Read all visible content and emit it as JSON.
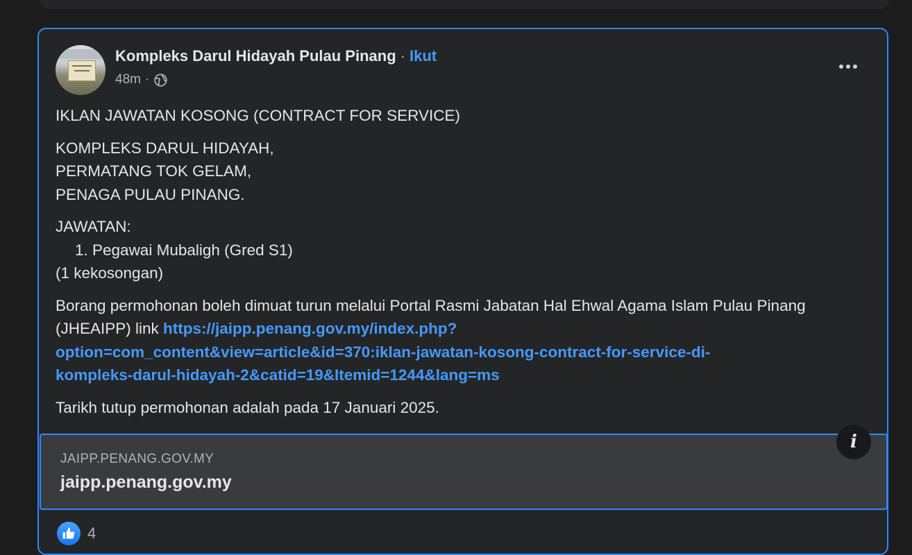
{
  "post": {
    "author": "Kompleks Darul Hidayah Pulau Pinang",
    "separator": "·",
    "follow_label": "Ikut",
    "time": "48m",
    "meta_separator": "·",
    "privacy_icon": "globe-icon",
    "more_icon": "more-options-icon",
    "body": {
      "p1": "IKLAN JAWATAN KOSONG (CONTRACT FOR SERVICE)",
      "address": [
        "KOMPLEKS DARUL HIDAYAH,",
        "PERMATANG TOK GELAM,",
        "PENAGA PULAU PINANG."
      ],
      "jawatan_label": "JAWATAN:",
      "jawatan_item": "1. Pegawai Mubaligh (Gred S1)",
      "vacancy": "(1 kekosongan)",
      "form_text": "Borang permohonan boleh dimuat turun melalui Portal  Rasmi Jabatan Hal Ehwal Agama Islam Pulau Pinang (JHEAIPP) link ",
      "link_url": "https://jaipp.penang.gov.my/index.php?option=com_content&view=article&id=370:iklan-jawatan-kosong-contract-for-service-di-kompleks-darul-hidayah-2&catid=19&Itemid=1244&lang=ms",
      "link_line1": "https://jaipp.penang.gov.my/index.php?",
      "link_line2": "option=com_content&view=article&id=370:iklan-jawatan-kosong-contract-for-service-di-",
      "link_line3": "kompleks-darul-hidayah-2&catid=19&Itemid=1244&lang=ms",
      "closing": "Tarikh tutup permohonan adalah pada 17 Januari 2025."
    },
    "link_preview": {
      "domain": "JAIPP.PENANG.GOV.MY",
      "title": "jaipp.penang.gov.my",
      "info_icon": "info-icon"
    },
    "reactions": {
      "icon": "like-icon",
      "count": "4"
    }
  },
  "colors": {
    "background": "#1c1c1d",
    "card": "#242526",
    "accent": "#2d88ff",
    "link": "#4599ff"
  }
}
